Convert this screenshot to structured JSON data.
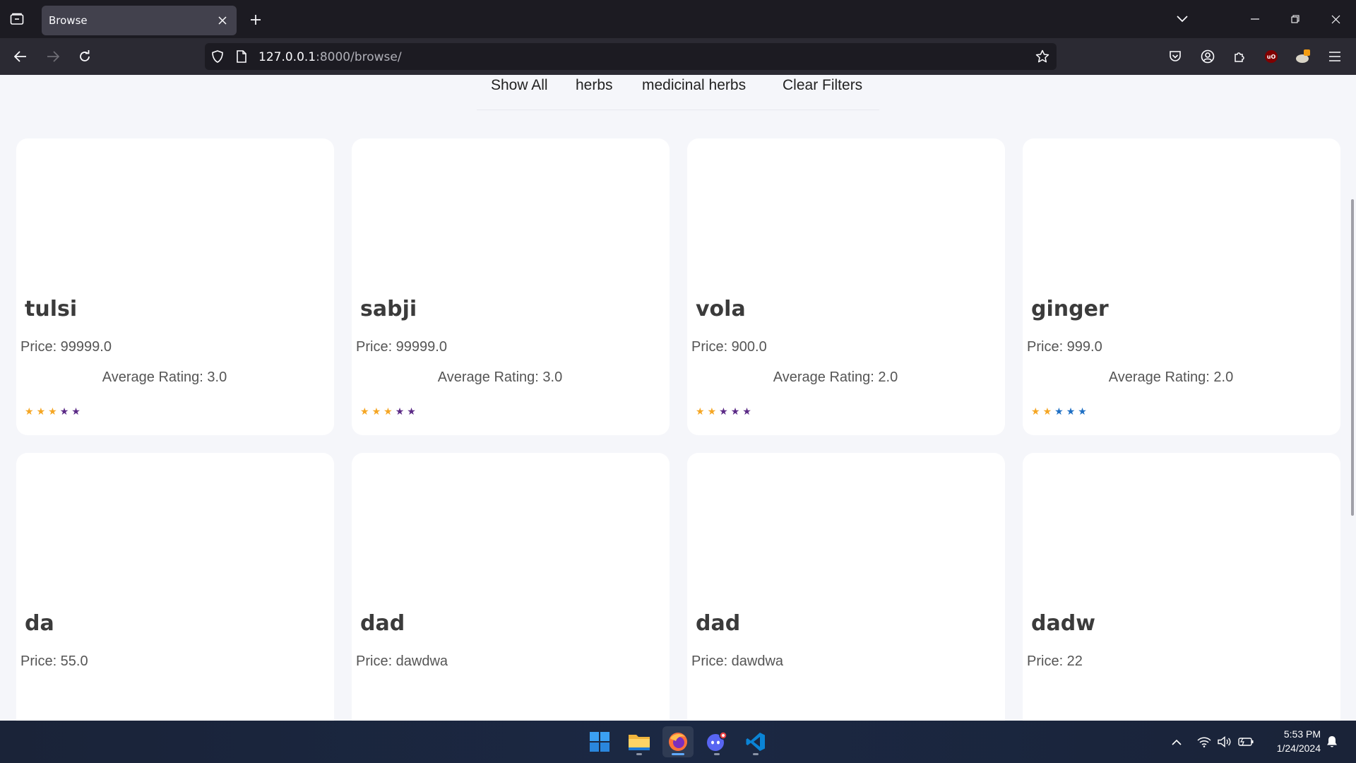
{
  "browser": {
    "tab_title": "Browse",
    "url_host": "127.0.0.1",
    "url_rest": ":8000/browse/"
  },
  "filters": [
    "Show All",
    "herbs",
    "medicinal herbs",
    "Clear Filters"
  ],
  "products": [
    {
      "name": "tulsi",
      "price": "Price: 99999.0",
      "rating": "Average Rating: 3.0",
      "stars": [
        "#f5a623",
        "#f5a623",
        "#f5a623",
        "#5b2a86",
        "#5b2a86"
      ]
    },
    {
      "name": "sabji",
      "price": "Price: 99999.0",
      "rating": "Average Rating: 3.0",
      "stars": [
        "#f5a623",
        "#f5a623",
        "#f5a623",
        "#5b2a86",
        "#5b2a86"
      ]
    },
    {
      "name": "vola",
      "price": "Price: 900.0",
      "rating": "Average Rating: 2.0",
      "stars": [
        "#f5a623",
        "#f5a623",
        "#5b2a86",
        "#5b2a86",
        "#5b2a86"
      ]
    },
    {
      "name": "ginger",
      "price": "Price: 999.0",
      "rating": "Average Rating: 2.0",
      "stars": [
        "#f5a623",
        "#f5a623",
        "#1e6fc4",
        "#1e6fc4",
        "#1e6fc4"
      ]
    },
    {
      "name": "da",
      "price": "Price: 55.0",
      "rating": "",
      "stars": []
    },
    {
      "name": "dad",
      "price": "Price: dawdwa",
      "rating": "",
      "stars": []
    },
    {
      "name": "dad",
      "price": "Price: dawdwa",
      "rating": "",
      "stars": []
    },
    {
      "name": "dadw",
      "price": "Price: 22",
      "rating": "",
      "stars": []
    }
  ],
  "taskbar": {
    "time": "5:53 PM",
    "date": "1/24/2024",
    "apps": [
      "start-icon",
      "file-explorer-icon",
      "firefox-icon",
      "discord-icon",
      "vscode-icon"
    ]
  }
}
